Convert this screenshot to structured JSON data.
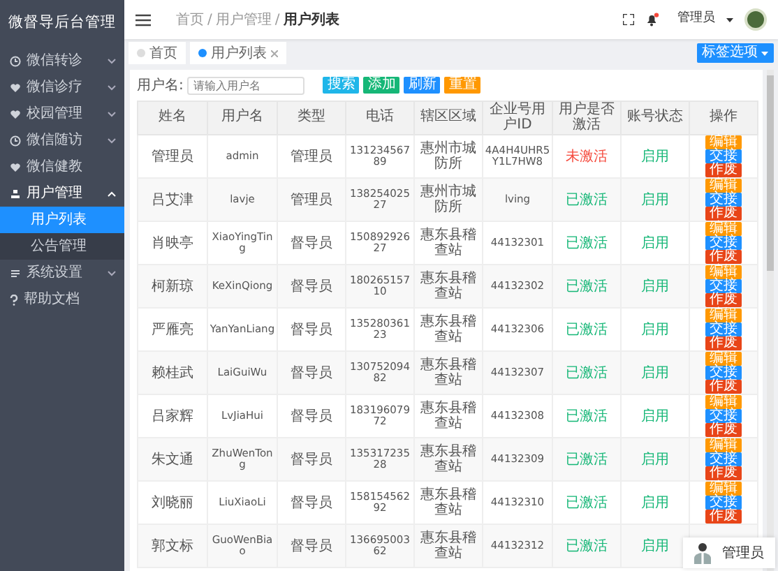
{
  "sidebar": {
    "title": "微督导后台管理",
    "items": [
      {
        "label": "微信转诊",
        "expanded": false
      },
      {
        "label": "微信诊疗",
        "expanded": false
      },
      {
        "label": "校园管理",
        "expanded": false
      },
      {
        "label": "微信随访",
        "expanded": false
      },
      {
        "label": "微信健教",
        "expanded": false
      },
      {
        "label": "用户管理",
        "expanded": true,
        "children": [
          {
            "label": "用户列表",
            "selected": true
          },
          {
            "label": "公告管理",
            "selected": false
          }
        ]
      },
      {
        "label": "系统设置",
        "expanded": false
      },
      {
        "label": "帮助文档",
        "expanded": false
      }
    ]
  },
  "breadcrumb": {
    "items": [
      "首页",
      "用户管理",
      "用户列表"
    ],
    "separator": "/"
  },
  "header": {
    "user": "管理员",
    "notification": true
  },
  "tabs": [
    {
      "label": "首页",
      "selected": false
    },
    {
      "label": "用户列表",
      "selected": true
    }
  ],
  "tab_options": "标签选项",
  "search": {
    "label": "用户名:",
    "placeholder": "请输入用户名",
    "buttons": [
      {
        "label": "搜索",
        "kind": "search"
      },
      {
        "label": "添加",
        "kind": "add"
      },
      {
        "label": "刷新",
        "kind": "refresh"
      },
      {
        "label": "重置",
        "kind": "reset"
      }
    ]
  },
  "table": {
    "columns": [
      "姓名",
      "用户名",
      "类型",
      "电话",
      "辖区区域",
      "企业号用户ID",
      "用户是否激活",
      "账号状态",
      "操作"
    ],
    "rows": [
      {
        "cells": [
          "管理员",
          "admin",
          "管理员",
          "13123456789",
          "惠州市城防所",
          "4A4H4UHR5Y1L7HW8"
        ],
        "activation": "未激活",
        "activated": false,
        "status": "启用",
        "enabled": true,
        "actions": [
          {
            "label": "编辑",
            "kind": "edit"
          },
          {
            "label": "交接",
            "kind": "handover"
          },
          {
            "label": "作废",
            "kind": "void"
          }
        ]
      },
      {
        "cells": [
          "吕艾津",
          "lavje",
          "管理员",
          "13825402527",
          "惠州市城防所",
          "lving"
        ],
        "activation": "已激活",
        "activated": true,
        "status": "启用",
        "enabled": true,
        "actions": [
          {
            "label": "编辑",
            "kind": "edit"
          },
          {
            "label": "交接",
            "kind": "handover"
          },
          {
            "label": "作废",
            "kind": "void"
          }
        ]
      },
      {
        "cells": [
          "肖映亭",
          "XiaoYingTing",
          "督导员",
          "15089292627",
          "惠东县稽查站",
          "44132301"
        ],
        "activation": "已激活",
        "activated": true,
        "status": "启用",
        "enabled": true,
        "actions": [
          {
            "label": "编辑",
            "kind": "edit"
          },
          {
            "label": "交接",
            "kind": "handover"
          },
          {
            "label": "作废",
            "kind": "void"
          }
        ]
      },
      {
        "cells": [
          "柯新琼",
          "KeXinQiong",
          "督导员",
          "18026515710",
          "惠东县稽查站",
          "44132302"
        ],
        "activation": "已激活",
        "activated": true,
        "status": "启用",
        "enabled": true,
        "actions": [
          {
            "label": "编辑",
            "kind": "edit"
          },
          {
            "label": "交接",
            "kind": "handover"
          },
          {
            "label": "作废",
            "kind": "void"
          }
        ]
      },
      {
        "cells": [
          "严雁亮",
          "YanYanLiang",
          "督导员",
          "13528036123",
          "惠东县稽查站",
          "44132306"
        ],
        "activation": "已激活",
        "activated": true,
        "status": "启用",
        "enabled": true,
        "actions": [
          {
            "label": "编辑",
            "kind": "edit"
          },
          {
            "label": "交接",
            "kind": "handover"
          },
          {
            "label": "作废",
            "kind": "void"
          }
        ]
      },
      {
        "cells": [
          "赖桂武",
          "LaiGuiWu",
          "督导员",
          "13075209482",
          "惠东县稽查站",
          "44132307"
        ],
        "activation": "已激活",
        "activated": true,
        "status": "启用",
        "enabled": true,
        "actions": [
          {
            "label": "编辑",
            "kind": "edit"
          },
          {
            "label": "交接",
            "kind": "handover"
          },
          {
            "label": "作废",
            "kind": "void"
          }
        ]
      },
      {
        "cells": [
          "吕家辉",
          "LvJiaHui",
          "督导员",
          "18319607972",
          "惠东县稽查站",
          "44132308"
        ],
        "activation": "已激活",
        "activated": true,
        "status": "启用",
        "enabled": true,
        "actions": [
          {
            "label": "编辑",
            "kind": "edit"
          },
          {
            "label": "交接",
            "kind": "handover"
          },
          {
            "label": "作废",
            "kind": "void"
          }
        ]
      },
      {
        "cells": [
          "朱文通",
          "ZhuWenTong",
          "督导员",
          "13531723528",
          "惠东县稽查站",
          "44132309"
        ],
        "activation": "已激活",
        "activated": true,
        "status": "启用",
        "enabled": true,
        "actions": [
          {
            "label": "编辑",
            "kind": "edit"
          },
          {
            "label": "交接",
            "kind": "handover"
          },
          {
            "label": "作废",
            "kind": "void"
          }
        ]
      },
      {
        "cells": [
          "刘晓丽",
          "LiuXiaoLi",
          "督导员",
          "15815456292",
          "惠东县稽查站",
          "44132310"
        ],
        "activation": "已激活",
        "activated": true,
        "status": "启用",
        "enabled": true,
        "actions": [
          {
            "label": "编辑",
            "kind": "edit"
          },
          {
            "label": "交接",
            "kind": "handover"
          },
          {
            "label": "作废",
            "kind": "void"
          }
        ]
      },
      {
        "cells": [
          "郭文标",
          "GuoWenBiao",
          "督导员",
          "13669500362",
          "惠东县稽查站",
          "44132312"
        ],
        "activation": "已激活",
        "activated": true,
        "status": "启用",
        "enabled": true
      }
    ]
  },
  "chat_widget": {
    "label": "管理员"
  }
}
